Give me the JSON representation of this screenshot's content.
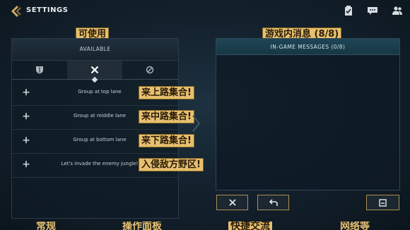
{
  "topbar": {
    "title": "SETTINGS",
    "icons": [
      "clipboard-check-icon",
      "chat-icon",
      "friends-icon"
    ]
  },
  "annotations": {
    "available": "可使用",
    "ingame": "游戏内消息 (8/8)",
    "top": "来上路集合!",
    "mid": "来中路集合!",
    "bottom": "来下路集合!",
    "jungle": "入侵敌方野区!"
  },
  "left_panel": {
    "header": "AVAILABLE",
    "tabs": [
      "shield-icon",
      "crossed-swords-icon",
      "ping-icon"
    ],
    "active_tab": 1,
    "rows": [
      {
        "label": "Group at top lane"
      },
      {
        "label": "Group at middle lane"
      },
      {
        "label": "Group at bottom lane"
      },
      {
        "label": "Let's invade the enemy jungle!"
      }
    ]
  },
  "right_panel": {
    "header": "IN-GAME MESSAGES (0/8)",
    "buttons": [
      "clear-button",
      "undo-button",
      "save-button"
    ]
  },
  "bottom_tabs": [
    "常规",
    "操作面板",
    "快捷交流",
    "网络等"
  ],
  "colors": {
    "accent": "#e6c070",
    "panel_header_right": "#1e4656",
    "background": "#14222e"
  }
}
